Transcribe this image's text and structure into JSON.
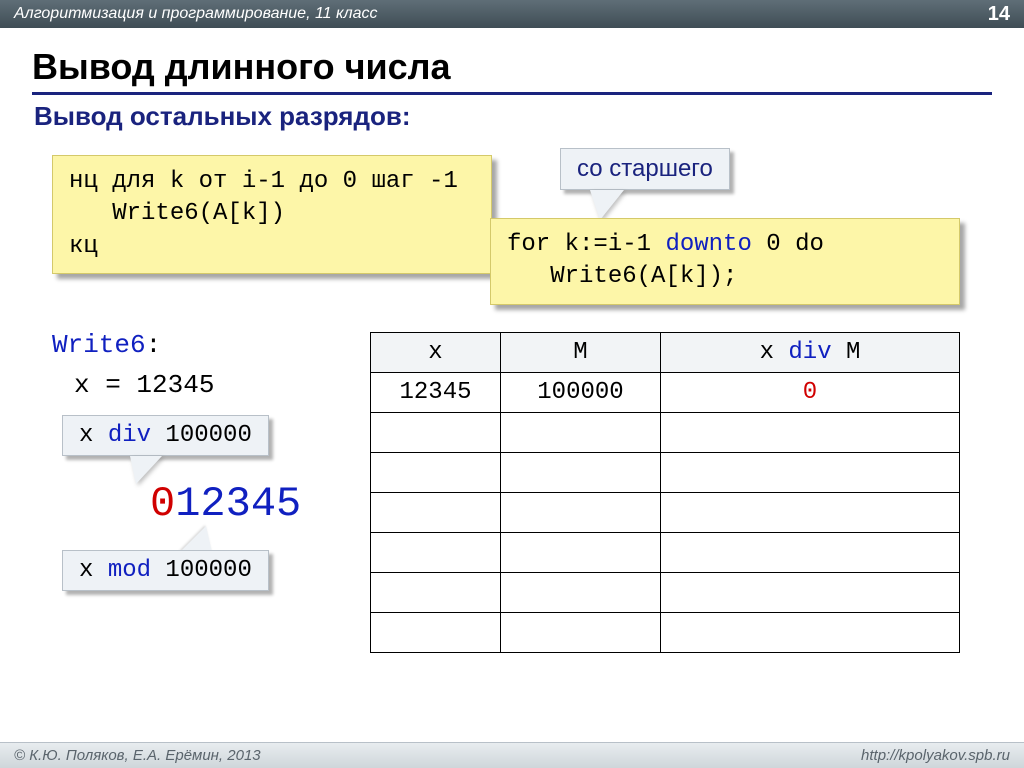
{
  "topbar": {
    "subject": "Алгоритмизация и программирование, 11 класс",
    "page": "14"
  },
  "title": "Вывод длинного числа",
  "subheading": "Вывод остальных разрядов:",
  "code_alg": "нц для k от i-1 до 0 шаг -1\n   Write6(A[k])\nкц",
  "code_pascal_l1_a": "for k:=i-1 ",
  "code_pascal_l1_b": "downto",
  "code_pascal_l1_c": " 0 do",
  "code_pascal_l2": "   Write6(A[k]);",
  "callout_top": "со старшего",
  "write6_label": "Write6",
  "x_assign": "x = 12345",
  "callout_div_a": "x ",
  "callout_div_b": "div",
  "callout_div_c": " 100000",
  "callout_mod_a": "x ",
  "callout_mod_b": "mod",
  "callout_mod_c": " 100000",
  "bignum": {
    "first": "0",
    "rest": "12345"
  },
  "table": {
    "h_x": "x",
    "h_M": "M",
    "h_res_a": "x ",
    "h_res_b": "div",
    "h_res_c": " M",
    "r0_x": "12345",
    "r0_M": "100000",
    "r0_res": "0"
  },
  "footer": {
    "left": "© К.Ю. Поляков, Е.А. Ерёмин, 2013",
    "right": "http://kpolyakov.spb.ru"
  }
}
